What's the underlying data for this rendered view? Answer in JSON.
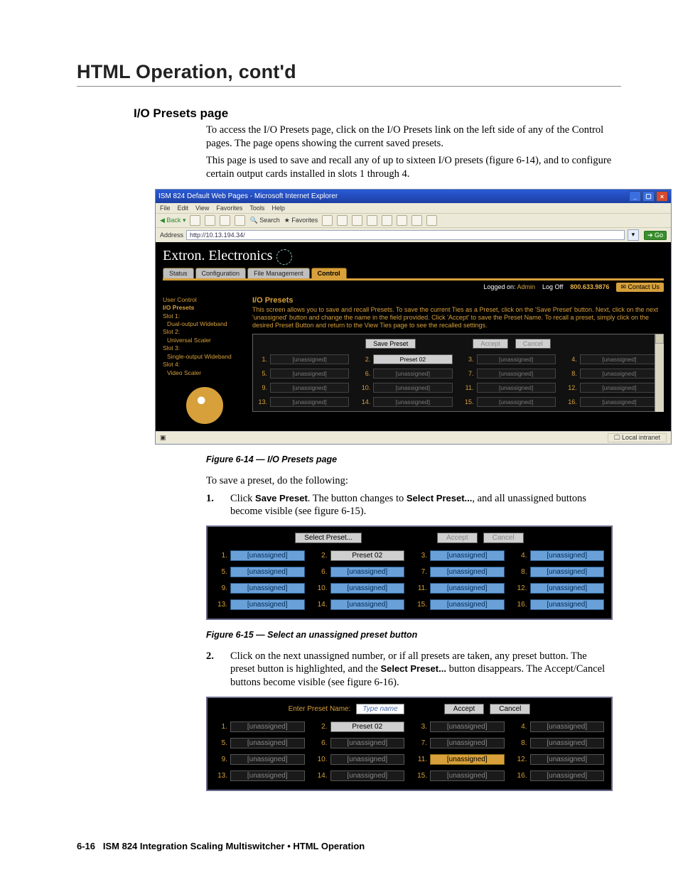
{
  "chapter_title": "HTML Operation, cont'd",
  "section_head": "I/O Presets page",
  "intro": [
    "To access the I/O Presets page, click on the I/O Presets link on the left side of any of the Control pages.  The page opens showing the current saved presets.",
    "This page is used to save and recall any of up to sixteen I/O presets (figure 6-14), and to configure certain output cards installed in slots 1 through 4."
  ],
  "fig14": {
    "window_title": "ISM 824 Default Web Pages - Microsoft Internet Explorer",
    "menus": [
      "File",
      "Edit",
      "View",
      "Favorites",
      "Tools",
      "Help"
    ],
    "toolbar": {
      "back": "Back",
      "search": "Search",
      "fav": "Favorites"
    },
    "address_label": "Address",
    "address_value": "http://10.13.194.34/",
    "go": "Go",
    "brand": "Extron. Electronics",
    "tabs": [
      "Status",
      "Configuration",
      "File Management",
      "Control"
    ],
    "active_tab_index": 3,
    "phone": "800.633.9876",
    "logged_on_label": "Logged on:",
    "logged_on_user": "Admin",
    "log_off": "Log Off",
    "contact": "Contact Us",
    "sidenav": [
      {
        "label": "User Control",
        "indent": 0
      },
      {
        "label": "I/O Presets",
        "indent": 0,
        "hl": true
      },
      {
        "label": "Slot 1:",
        "indent": 0
      },
      {
        "label": "Dual-output Wideband",
        "indent": 1
      },
      {
        "label": "Slot 2:",
        "indent": 0
      },
      {
        "label": "Universal Scaler",
        "indent": 1
      },
      {
        "label": "Slot 3:",
        "indent": 0
      },
      {
        "label": "Single-output Wideband",
        "indent": 1
      },
      {
        "label": "Slot 4:",
        "indent": 0
      },
      {
        "label": "Video Scaler",
        "indent": 1
      }
    ],
    "panel_title": "I/O Presets",
    "panel_desc": "This screen allows you to save and recall Presets. To save the current Ties as a Preset, click on the 'Save Preset' button. Next, click on the next 'unassigned' button and change the name in the field provided. Click 'Accept' to save the Preset Name. To recall a preset, simply click on the desired Preset Button and return to the View Ties page to see the recalled settings.",
    "save_btn": "Save Preset",
    "accept": "Accept",
    "cancel": "Cancel",
    "presets": [
      {
        "n": 1,
        "label": "[unassigned]",
        "state": "unas"
      },
      {
        "n": 2,
        "label": "Preset 02",
        "state": "named"
      },
      {
        "n": 3,
        "label": "[unassigned]",
        "state": "unas"
      },
      {
        "n": 4,
        "label": "[unassigned]",
        "state": "unas"
      },
      {
        "n": 5,
        "label": "[unassigned]",
        "state": "unas"
      },
      {
        "n": 6,
        "label": "[unassigned]",
        "state": "unas"
      },
      {
        "n": 7,
        "label": "[unassigned]",
        "state": "unas"
      },
      {
        "n": 8,
        "label": "[unassigned]",
        "state": "unas"
      },
      {
        "n": 9,
        "label": "[unassigned]",
        "state": "unas"
      },
      {
        "n": 10,
        "label": "[unassigned]",
        "state": "unas"
      },
      {
        "n": 11,
        "label": "[unassigned]",
        "state": "unas"
      },
      {
        "n": 12,
        "label": "[unassigned]",
        "state": "unas"
      },
      {
        "n": 13,
        "label": "[unassigned]",
        "state": "unas"
      },
      {
        "n": 14,
        "label": "[unassigned]",
        "state": "unas"
      },
      {
        "n": 15,
        "label": "[unassigned]",
        "state": "unas"
      },
      {
        "n": 16,
        "label": "[unassigned]",
        "state": "unas"
      }
    ],
    "statusbar_zone": "Local intranet"
  },
  "cap14": "Figure 6-14 — I/O Presets page",
  "after14": "To save a preset, do the following:",
  "step1": {
    "num": "1.",
    "pre": "Click ",
    "b1": "Save Preset",
    "mid": ".  The button changes to ",
    "b2": "Select Preset...",
    "post": ", and all unassigned buttons become visible (see figure 6-15)."
  },
  "fig15": {
    "top_btn": "Select Preset...",
    "accept": "Accept",
    "cancel": "Cancel",
    "cells": [
      {
        "n": 1,
        "label": "[unassigned]",
        "cls": "blue"
      },
      {
        "n": 2,
        "label": "Preset 02",
        "cls": "gray"
      },
      {
        "n": 3,
        "label": "[unassigned]",
        "cls": "blue"
      },
      {
        "n": 4,
        "label": "[unassigned]",
        "cls": "blue"
      },
      {
        "n": 5,
        "label": "[unassigned]",
        "cls": "blue"
      },
      {
        "n": 6,
        "label": "[unassigned]",
        "cls": "blue"
      },
      {
        "n": 7,
        "label": "[unassigned]",
        "cls": "blue"
      },
      {
        "n": 8,
        "label": "[unassigned]",
        "cls": "blue"
      },
      {
        "n": 9,
        "label": "[unassigned]",
        "cls": "blue"
      },
      {
        "n": 10,
        "label": "[unassigned]",
        "cls": "blue"
      },
      {
        "n": 11,
        "label": "[unassigned]",
        "cls": "blue"
      },
      {
        "n": 12,
        "label": "[unassigned]",
        "cls": "blue"
      },
      {
        "n": 13,
        "label": "[unassigned]",
        "cls": "blue"
      },
      {
        "n": 14,
        "label": "[unassigned]",
        "cls": "blue"
      },
      {
        "n": 15,
        "label": "[unassigned]",
        "cls": "blue"
      },
      {
        "n": 16,
        "label": "[unassigned]",
        "cls": "blue"
      }
    ]
  },
  "cap15": "Figure 6-15 — Select an unassigned preset button",
  "step2": {
    "num": "2.",
    "pre": "Click on the next unassigned number, or if all presets are taken, any preset button.  The preset button is highlighted, and the ",
    "b1": "Select Preset...",
    "post": " button disappears.  The Accept/Cancel buttons become visible (see figure 6-16)."
  },
  "fig16": {
    "label": "Enter Preset Name:",
    "input": "Type name",
    "accept": "Accept",
    "cancel": "Cancel",
    "cells": [
      {
        "n": 1,
        "label": "[unassigned]",
        "cls": "unas"
      },
      {
        "n": 2,
        "label": "Preset 02",
        "cls": "gray"
      },
      {
        "n": 3,
        "label": "[unassigned]",
        "cls": "unas"
      },
      {
        "n": 4,
        "label": "[unassigned]",
        "cls": "unas"
      },
      {
        "n": 5,
        "label": "[unassigned]",
        "cls": "unas"
      },
      {
        "n": 6,
        "label": "[unassigned]",
        "cls": "unas"
      },
      {
        "n": 7,
        "label": "[unassigned]",
        "cls": "unas"
      },
      {
        "n": 8,
        "label": "[unassigned]",
        "cls": "unas"
      },
      {
        "n": 9,
        "label": "[unassigned]",
        "cls": "unas"
      },
      {
        "n": 10,
        "label": "[unassigned]",
        "cls": "unas"
      },
      {
        "n": 11,
        "label": "[unassigned]",
        "cls": "sel"
      },
      {
        "n": 12,
        "label": "[unassigned]",
        "cls": "unas"
      },
      {
        "n": 13,
        "label": "[unassigned]",
        "cls": "unas"
      },
      {
        "n": 14,
        "label": "[unassigned]",
        "cls": "unas"
      },
      {
        "n": 15,
        "label": "[unassigned]",
        "cls": "unas"
      },
      {
        "n": 16,
        "label": "[unassigned]",
        "cls": "unas"
      }
    ]
  },
  "footer": {
    "pn": "6-16",
    "ttl": "ISM 824 Integration Scaling Multiswitcher • HTML Operation"
  }
}
